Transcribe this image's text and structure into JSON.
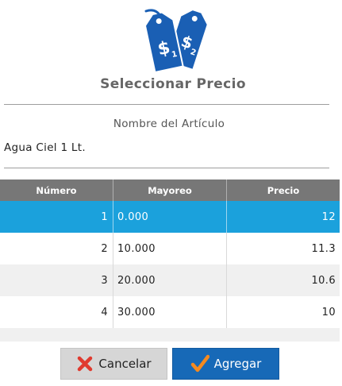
{
  "dialog": {
    "title": "Seleccionar Precio",
    "item_label": "Nombre del Artículo",
    "item_name": "Agua Ciel 1 Lt.",
    "logo_icon": "price-tags-icon",
    "logo_tags": [
      "$1",
      "$2"
    ],
    "accent_color": "#1ba1dc"
  },
  "table": {
    "headers": [
      "Número",
      "Mayoreo",
      "Precio"
    ],
    "rows": [
      {
        "numero": "1",
        "mayoreo": "0.000",
        "precio": "12",
        "selected": true
      },
      {
        "numero": "2",
        "mayoreo": "10.000",
        "precio": "11.3",
        "selected": false
      },
      {
        "numero": "3",
        "mayoreo": "20.000",
        "precio": "10.6",
        "selected": false
      },
      {
        "numero": "4",
        "mayoreo": "30.000",
        "precio": "10",
        "selected": false
      }
    ]
  },
  "buttons": {
    "cancel_label": "Cancelar",
    "cancel_icon": "red-x-icon",
    "add_label": "Agregar",
    "add_icon": "orange-checkmark-icon"
  }
}
